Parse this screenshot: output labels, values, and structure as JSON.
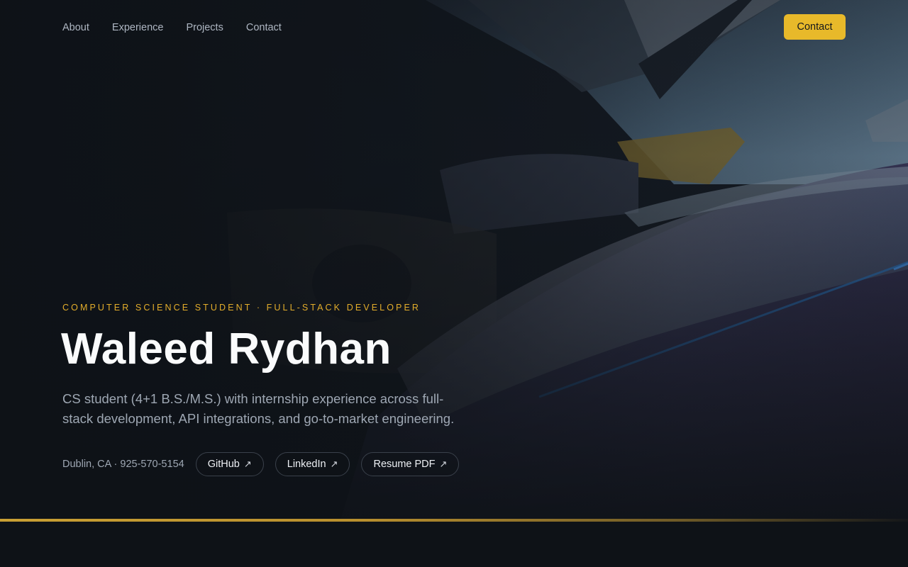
{
  "nav": {
    "links": [
      "About",
      "Experience",
      "Projects",
      "Contact"
    ],
    "cta_label": "Contact"
  },
  "hero": {
    "eyebrow": "COMPUTER SCIENCE STUDENT · FULL-STACK DEVELOPER",
    "name": "Waleed Rydhan",
    "summary": "CS student (4+1 B.S./M.S.) with internship experience across full-stack development, API integrations, and go-to-market engineering.",
    "contact_info": "Dublin, CA · 925-570-5154",
    "links": [
      {
        "label": "GitHub",
        "icon": "external-link-arrow-icon"
      },
      {
        "label": "LinkedIn",
        "icon": "external-link-arrow-icon"
      },
      {
        "label": "Resume PDF",
        "icon": "external-link-arrow-icon"
      }
    ],
    "arrow_glyph": "↗",
    "background": "dark photo of supercars in a hangar"
  },
  "colors": {
    "accent": "#e8b92a",
    "background": "#0e1217",
    "muted_text": "#9ea7b3"
  }
}
